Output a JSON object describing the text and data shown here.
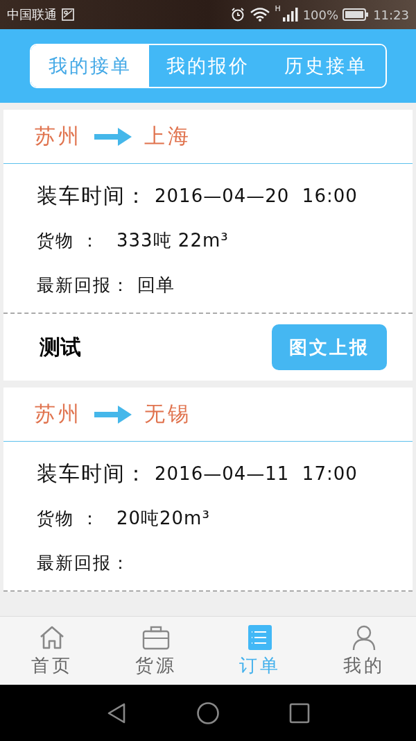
{
  "status_bar": {
    "carrier": "中国联通",
    "network": "H",
    "battery": "100%",
    "time": "11:23"
  },
  "tabs": [
    {
      "label": "我的接单",
      "selected": true
    },
    {
      "label": "我的报价",
      "selected": false
    },
    {
      "label": "历史接单",
      "selected": false
    }
  ],
  "orders": [
    {
      "from": "苏州",
      "to": "上海",
      "load_time_label": "装车时间：",
      "load_time": "2016—04—20  16:00",
      "cargo_label": "货物 ：",
      "cargo": "333吨 22m³",
      "report_label": "最新回报：",
      "report": "回单",
      "name": "测试",
      "action": "图文上报"
    },
    {
      "from": "苏州",
      "to": "无锡",
      "load_time_label": "装车时间：",
      "load_time": "2016—04—11  17:00",
      "cargo_label": "货物 ：",
      "cargo": "20吨20m³",
      "report_label": "最新回报："
    }
  ],
  "bottom_nav": [
    {
      "label": "首页",
      "selected": false
    },
    {
      "label": "货源",
      "selected": false
    },
    {
      "label": "订单",
      "selected": true
    },
    {
      "label": "我的",
      "selected": false
    }
  ]
}
